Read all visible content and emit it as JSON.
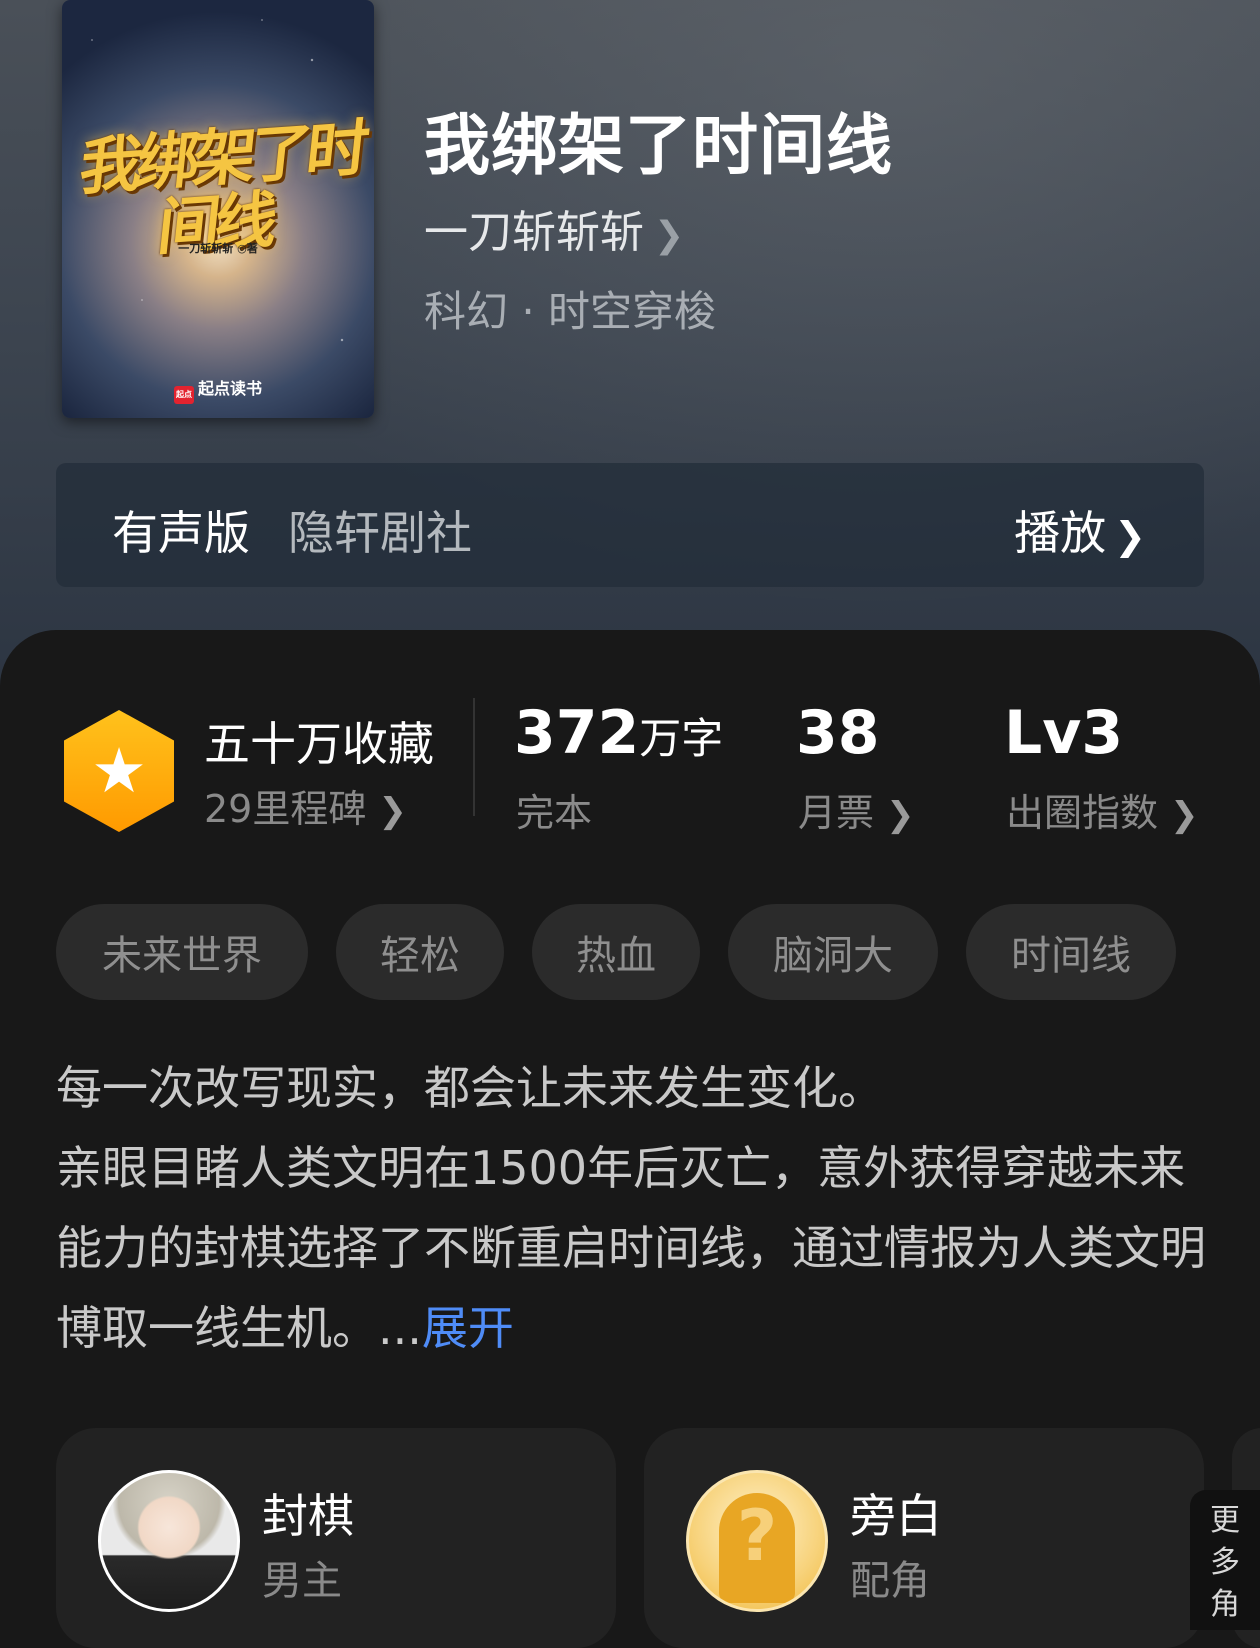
{
  "book": {
    "cover_title": "我绑架了时间线",
    "cover_author": "一刀斩斩斩 ◎著",
    "cover_publisher": "起点读书",
    "cover_publisher_logo": "起点",
    "title": "我绑架了时间线",
    "author": "一刀斩斩斩",
    "genre": "科幻 · 时空穿梭"
  },
  "audio": {
    "label": "有声版",
    "studio": "隐轩剧社",
    "play_label": "播放"
  },
  "stats": {
    "collections_label": "五十万收藏",
    "milestones_label": "29里程碑",
    "word_count": "372",
    "word_unit": "万字",
    "status": "完本",
    "monthly_tickets": "38",
    "monthly_tickets_label": "月票",
    "level": "Lv3",
    "level_label": "出圈指数"
  },
  "tags": [
    "未来世界",
    "轻松",
    "热血",
    "脑洞大",
    "时间线"
  ],
  "description": {
    "line1": "每一次改写现实，都会让未来发生变化。",
    "line2": "亲眼目睹人类文明在1500年后灭亡，意外获得穿越未来能力的封棋选择了不断重启时间线，通过情报为人类文明博取一线生机。...",
    "expand_label": "展开"
  },
  "characters": [
    {
      "name": "封棋",
      "role": "男主"
    },
    {
      "name": "旁白",
      "role": "配角"
    }
  ],
  "more_label": "更多角",
  "icons": {
    "author_chevron": "chevron-right-icon",
    "star": "star-icon",
    "mystery_avatar": "question-mark-icon"
  },
  "colors": {
    "accent_link": "#4f8cf7",
    "badge_gold": "#ffb000"
  }
}
